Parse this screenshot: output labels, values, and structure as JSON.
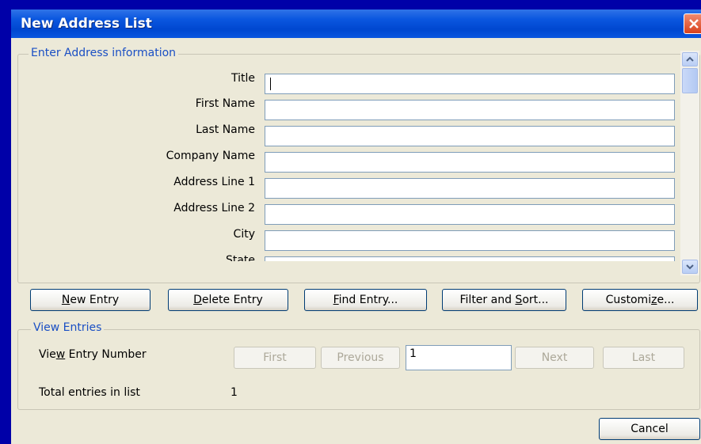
{
  "window": {
    "title": "New Address List",
    "close_icon": "close-icon",
    "close_color": "#d9411c",
    "titlebar_color": "#0a56df"
  },
  "address_group": {
    "legend": "Enter Address information",
    "fields": [
      {
        "label": "Title",
        "value": ""
      },
      {
        "label": "First Name",
        "value": ""
      },
      {
        "label": "Last Name",
        "value": ""
      },
      {
        "label": "Company Name",
        "value": ""
      },
      {
        "label": "Address Line 1",
        "value": ""
      },
      {
        "label": "Address Line 2",
        "value": ""
      },
      {
        "label": "City",
        "value": ""
      },
      {
        "label": "State",
        "value": ""
      }
    ]
  },
  "buttons": {
    "new_entry": {
      "pre": "",
      "key": "N",
      "post": "ew Entry"
    },
    "delete_entry": {
      "pre": "",
      "key": "D",
      "post": "elete Entry"
    },
    "find_entry": {
      "pre": "",
      "key": "F",
      "post": "ind Entry..."
    },
    "filter_sort": {
      "pre": "Filter and ",
      "key": "S",
      "post": "ort..."
    },
    "customize": {
      "pre": "Customi",
      "key": "z",
      "post": "e..."
    }
  },
  "view_group": {
    "legend": "View Entries",
    "entry_number_label": {
      "pre": "Vie",
      "key": "w",
      "post": " Entry Number"
    },
    "nav": {
      "first": "First",
      "previous": "Previous",
      "next": "Next",
      "last": "Last"
    },
    "entry_number_value": "1",
    "total_label": "Total entries in list",
    "total_value": "1"
  },
  "footer": {
    "cancel": "Cancel"
  }
}
